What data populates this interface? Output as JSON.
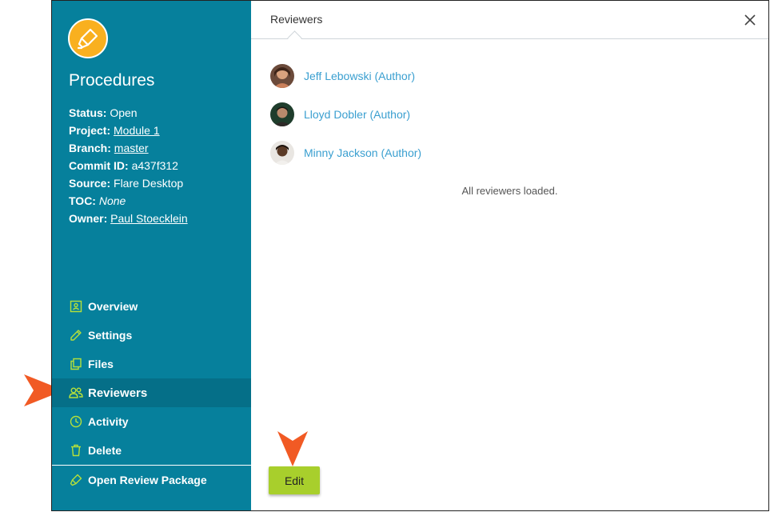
{
  "project": {
    "title": "Procedures",
    "meta": [
      {
        "label": "Status:",
        "value": "Open",
        "style": "plain"
      },
      {
        "label": "Project:",
        "value": "Module 1",
        "style": "link"
      },
      {
        "label": "Branch:",
        "value": "master",
        "style": "link"
      },
      {
        "label": "Commit ID:",
        "value": "a437f312",
        "style": "plain"
      },
      {
        "label": "Source:",
        "value": "Flare Desktop",
        "style": "plain"
      },
      {
        "label": "TOC:",
        "value": "None",
        "style": "italic"
      },
      {
        "label": "Owner:",
        "value": "Paul Stoecklein",
        "style": "link"
      }
    ]
  },
  "nav": {
    "items": [
      {
        "label": "Overview",
        "icon": "overview-icon"
      },
      {
        "label": "Settings",
        "icon": "pencil-icon"
      },
      {
        "label": "Files",
        "icon": "files-icon"
      },
      {
        "label": "Reviewers",
        "icon": "users-icon",
        "active": true
      },
      {
        "label": "Activity",
        "icon": "clock-icon"
      },
      {
        "label": "Delete",
        "icon": "trash-icon"
      }
    ],
    "open_package": "Open Review Package"
  },
  "panel": {
    "tab": "Reviewers",
    "reviewers": [
      {
        "name": "Jeff Lebowski (Author)"
      },
      {
        "name": "Lloyd Dobler (Author)"
      },
      {
        "name": "Minny Jackson (Author)"
      }
    ],
    "status": "All reviewers loaded.",
    "edit_label": "Edit"
  },
  "colors": {
    "sidebar": "#06809c",
    "sidebar_active": "#056f88",
    "icon_accent": "#b6e03a",
    "logo": "#f9b01f",
    "link": "#3a9fd0",
    "edit_button": "#a8cf2c",
    "callout": "#f15a24"
  }
}
